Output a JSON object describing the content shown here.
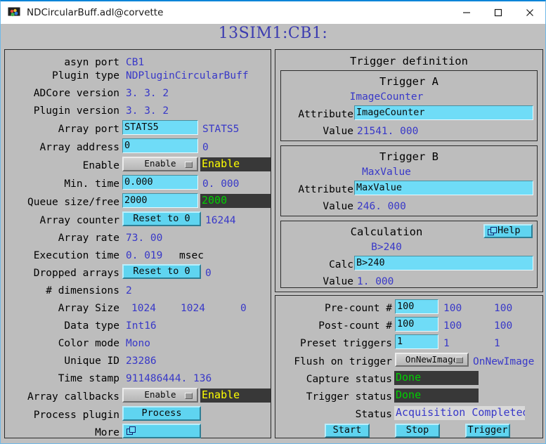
{
  "window": {
    "title": "NDCircularBuff.adl@corvette",
    "icon": "app-icon",
    "minimize_label": "minimize-icon",
    "maximize_label": "maximize-icon",
    "close_label": "close-icon"
  },
  "header": {
    "prefix": "13SIM1:CB1:"
  },
  "colors": {
    "panel_bg": "#bdbdbd",
    "value_blue": "#3838c8",
    "entry_cyan": "#6fdcf7",
    "button_cyan": "#5fd4f0",
    "status_dark": "#383838",
    "status_yellow": "#ffff00",
    "status_green": "#00d000",
    "title_accent": "#0a84d8"
  },
  "left_panel": {
    "rows": {
      "asyn_port": {
        "label": "asyn port",
        "value": "CB1"
      },
      "plugin_type": {
        "label": "Plugin type",
        "value": "NDPluginCircularBuff"
      },
      "adcore_version": {
        "label": "ADCore version",
        "value": "3. 3. 2"
      },
      "plugin_version": {
        "label": "Plugin version",
        "value": "3. 3. 2"
      },
      "array_port": {
        "label": "Array port",
        "entry": "STATS5",
        "value": "STATS5"
      },
      "array_address": {
        "label": "Array address",
        "entry": "0",
        "value": "0"
      },
      "enable": {
        "label": "Enable",
        "menu": "Enable",
        "status": "Enable"
      },
      "min_time": {
        "label": "Min. time",
        "entry": "0.000",
        "value": "0. 000"
      },
      "queue_size_free": {
        "label": "Queue size/free",
        "entry": "2000",
        "status": "2000"
      },
      "array_counter": {
        "label": "Array counter",
        "button": "Reset to 0",
        "value": "16244"
      },
      "array_rate": {
        "label": "Array rate",
        "value": "73. 00"
      },
      "execution_time": {
        "label": "Execution time",
        "value": "0. 019",
        "units": "msec"
      },
      "dropped_arrays": {
        "label": "Dropped arrays",
        "button": "Reset to 0",
        "value": "0"
      },
      "num_dimensions": {
        "label": "# dimensions",
        "value": "2"
      },
      "array_size": {
        "label": "Array Size",
        "value_x": "1024",
        "value_y": "1024",
        "value_z": "0"
      },
      "data_type": {
        "label": "Data type",
        "value": "Int16"
      },
      "color_mode": {
        "label": "Color mode",
        "value": "Mono"
      },
      "unique_id": {
        "label": "Unique ID",
        "value": "23286"
      },
      "time_stamp": {
        "label": "Time stamp",
        "value": "911486444. 136"
      },
      "array_callbacks": {
        "label": "Array callbacks",
        "menu": "Enable",
        "status": "Enable"
      },
      "process_plugin": {
        "label": "Process plugin",
        "button": "Process"
      },
      "more": {
        "label": "More",
        "button": ""
      }
    }
  },
  "trigger_definition": {
    "title": "Trigger definition",
    "trigger_a": {
      "title": "Trigger A",
      "name": "ImageCounter",
      "attribute_label": "Attribute",
      "attribute_entry": "ImageCounter",
      "value_label": "Value",
      "value": "21541. 000"
    },
    "trigger_b": {
      "title": "Trigger B",
      "name": "MaxValue",
      "attribute_label": "Attribute",
      "attribute_entry": "MaxValue",
      "value_label": "Value",
      "value": "246. 000"
    },
    "calculation": {
      "title": "Calculation",
      "help_label": "Help",
      "expression": "B>240",
      "calc_label": "Calc",
      "calc_entry": "B>240",
      "value_label": "Value",
      "value": "1. 000"
    }
  },
  "capture_panel": {
    "rows": {
      "pre_count": {
        "label": "Pre-count #",
        "entry": "100",
        "value": "100",
        "readback": "100"
      },
      "post_count": {
        "label": "Post-count #",
        "entry": "100",
        "value": "100",
        "readback": "100"
      },
      "preset_triggers": {
        "label": "Preset triggers",
        "entry": "1",
        "value": "1",
        "readback": "1"
      },
      "flush_on_trigger": {
        "label": "Flush on trigger",
        "menu": "OnNewImage",
        "value": "OnNewImage"
      },
      "capture_status": {
        "label": "Capture status",
        "status": "Done"
      },
      "trigger_status": {
        "label": "Trigger status",
        "status": "Done"
      },
      "status": {
        "label": "Status",
        "status": "Acquisition Completed"
      }
    },
    "buttons": {
      "start": "Start",
      "stop": "Stop",
      "trigger": "Trigger"
    }
  }
}
